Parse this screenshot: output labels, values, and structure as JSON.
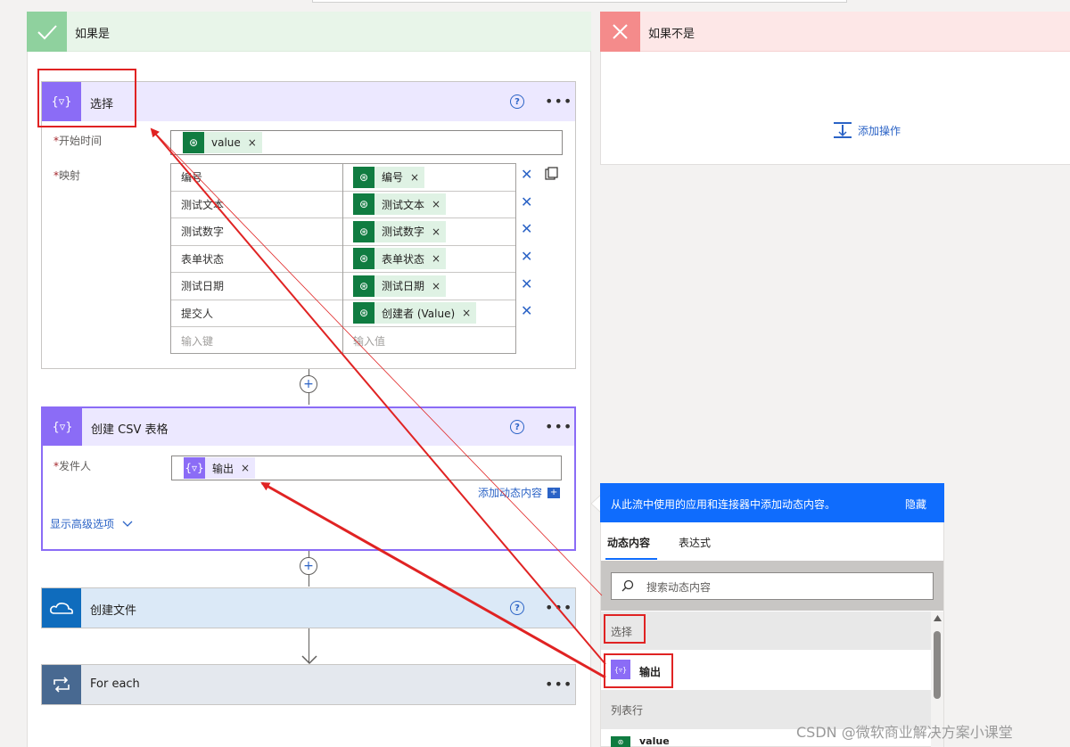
{
  "yes_branch": {
    "title": "如果是"
  },
  "no_branch": {
    "title": "如果不是",
    "add_action": "添加操作"
  },
  "select_card": {
    "title": "选择",
    "from_label": "开始时间",
    "from_token": "value",
    "map_label": "映射",
    "rows": [
      {
        "key": "编号",
        "value": "编号"
      },
      {
        "key": "测试文本",
        "value": "测试文本"
      },
      {
        "key": "测试数字",
        "value": "测试数字"
      },
      {
        "key": "表单状态",
        "value": "表单状态"
      },
      {
        "key": "测试日期",
        "value": "测试日期"
      },
      {
        "key": "提交人",
        "value": "创建者 (Value)"
      }
    ],
    "key_placeholder": "输入键",
    "value_placeholder": "输入值"
  },
  "csv_card": {
    "title": "创建 CSV 表格",
    "from_label": "发件人",
    "from_token": "输出",
    "add_dynamic": "添加动态内容",
    "advanced": "显示高级选项"
  },
  "file_card": {
    "title": "创建文件"
  },
  "foreach_card": {
    "title": "For each"
  },
  "dynamic_panel": {
    "header": "从此流中使用的应用和连接器中添加动态内容。",
    "hide": "隐藏",
    "tabs": [
      "动态内容",
      "表达式"
    ],
    "search_placeholder": "搜索动态内容",
    "section_select": "选择",
    "item_output": "输出",
    "section_list": "列表行",
    "item_value": "value"
  },
  "watermark": "CSDN @微软商业解决方案小课堂",
  "colors": {
    "accent": "#2b63c6",
    "annotation": "#e02323",
    "purple": "#8b6cf6",
    "dataverse": "#107c41"
  }
}
